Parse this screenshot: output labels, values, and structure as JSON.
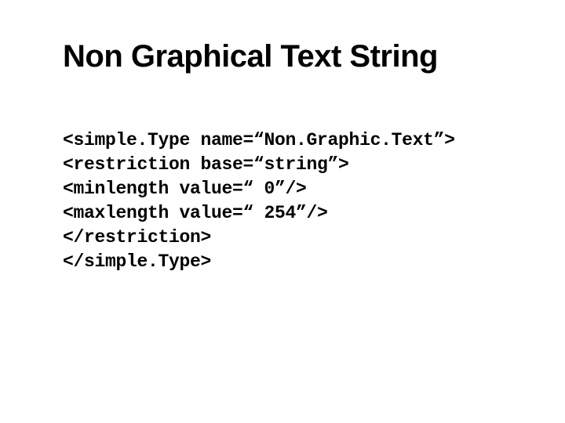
{
  "title": "Non Graphical Text String",
  "code": {
    "l1": "<simple.Type name=“Non.Graphic.Text”>",
    "l2": "<restriction base=“string”>",
    "l3": "<minlength value=“ 0”/>",
    "l4": "<maxlength value=“ 254”/>",
    "l5": "</restriction>",
    "l6": "</simple.Type>"
  }
}
